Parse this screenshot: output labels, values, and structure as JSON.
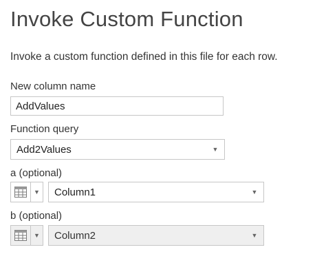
{
  "dialog": {
    "title": "Invoke Custom Function",
    "description": "Invoke a custom function defined in this file for each row."
  },
  "new_column": {
    "label": "New column name",
    "value": "AddValues"
  },
  "function_query": {
    "label": "Function query",
    "selected": "Add2Values"
  },
  "param_a": {
    "label": "a (optional)",
    "type_icon": "table-column-icon",
    "selected": "Column1"
  },
  "param_b": {
    "label": "b (optional)",
    "type_icon": "table-column-icon",
    "selected": "Column2"
  },
  "icons": {
    "caret": "▼"
  }
}
